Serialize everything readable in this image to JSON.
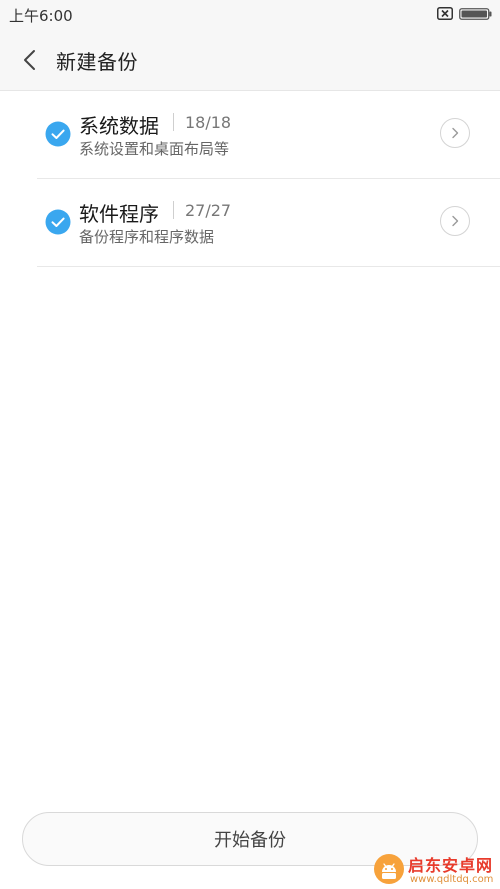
{
  "status_bar": {
    "time": "上午6:00",
    "sim_icon": "sim-off-icon",
    "battery_icon": "battery-icon"
  },
  "header": {
    "back_icon": "back-chevron-icon",
    "title": "新建备份"
  },
  "items": [
    {
      "title": "系统数据",
      "count": "18/18",
      "subtitle": "系统设置和桌面布局等",
      "checked": true
    },
    {
      "title": "软件程序",
      "count": "27/27",
      "subtitle": "备份程序和程序数据",
      "checked": true
    }
  ],
  "footer": {
    "start_label": "开始备份"
  },
  "watermark": {
    "title": "启东安卓网",
    "url": "www.qdltdq.com"
  },
  "colors": {
    "accent": "#3aa7ef",
    "watermark": "#e83b2c"
  }
}
